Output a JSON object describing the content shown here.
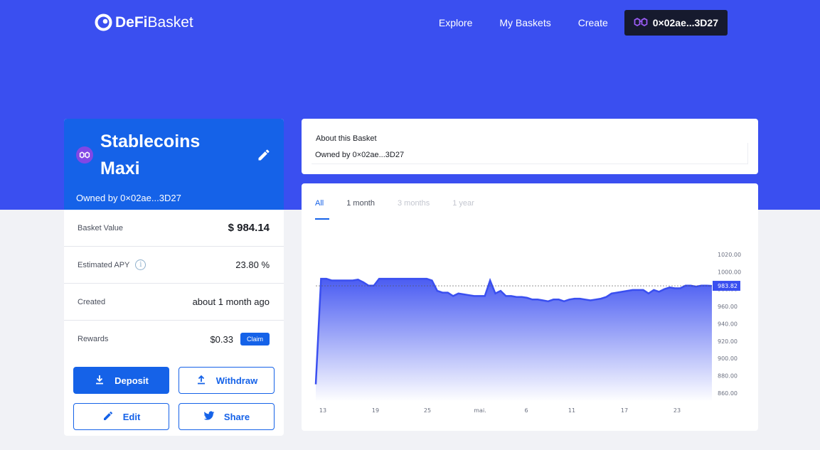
{
  "brand": {
    "bold": "DeFi",
    "light": "Basket"
  },
  "nav": {
    "links": [
      "Explore",
      "My Baskets",
      "Create"
    ],
    "wallet": "0×02ae...3D27"
  },
  "basket": {
    "name_line1": "Stablecoins",
    "name_line2": "Maxi",
    "owner": "Owned by 0×02ae...3D27",
    "stats": {
      "value_label": "Basket Value",
      "value": "$ 984.14",
      "apy_label": "Estimated APY",
      "apy": "23.80 %",
      "info_glyph": "i",
      "created_label": "Created",
      "created": "about 1 month ago",
      "rewards_label": "Rewards",
      "rewards": "$0.33",
      "claim": "Claim"
    },
    "buttons": {
      "deposit": "Deposit",
      "withdraw": "Withdraw",
      "edit": "Edit",
      "share": "Share"
    }
  },
  "about": {
    "title": "About this Basket",
    "owner": "Owned by 0×02ae...3D27"
  },
  "chart": {
    "tabs": [
      "All",
      "1 month",
      "3 months",
      "1 year"
    ],
    "active_tab": "All"
  },
  "chart_data": {
    "type": "area",
    "x_ticks": [
      "13",
      "19",
      "25",
      "mai.",
      "6",
      "11",
      "17",
      "23"
    ],
    "y_ticks": [
      "1020.00",
      "1000.00",
      "980.00",
      "960.00",
      "940.00",
      "920.00",
      "900.00",
      "880.00",
      "860.00"
    ],
    "ylim": [
      850,
      1020
    ],
    "current_label": "983.82",
    "current_value": 983.82,
    "y_values": [
      870,
      992,
      992,
      990,
      990,
      990,
      990,
      990,
      991,
      988,
      984,
      984,
      992,
      992,
      992,
      992,
      992,
      992,
      992,
      992,
      992,
      992,
      990,
      978,
      976,
      976,
      972,
      975,
      974,
      973,
      972,
      972,
      972,
      990,
      975,
      978,
      972,
      972,
      971,
      971,
      970,
      968,
      968,
      967,
      966,
      968,
      968,
      966,
      968,
      969,
      969,
      968,
      967,
      968,
      969,
      971,
      975,
      976,
      977,
      978,
      979,
      979,
      979,
      975,
      979,
      977,
      980,
      982,
      981,
      981,
      984,
      984,
      983,
      984,
      984,
      983.82
    ],
    "colors": {
      "line": "#3a4ff0",
      "fill_top": "#4a5cf2",
      "fill_bottom": "#ffffff"
    }
  }
}
